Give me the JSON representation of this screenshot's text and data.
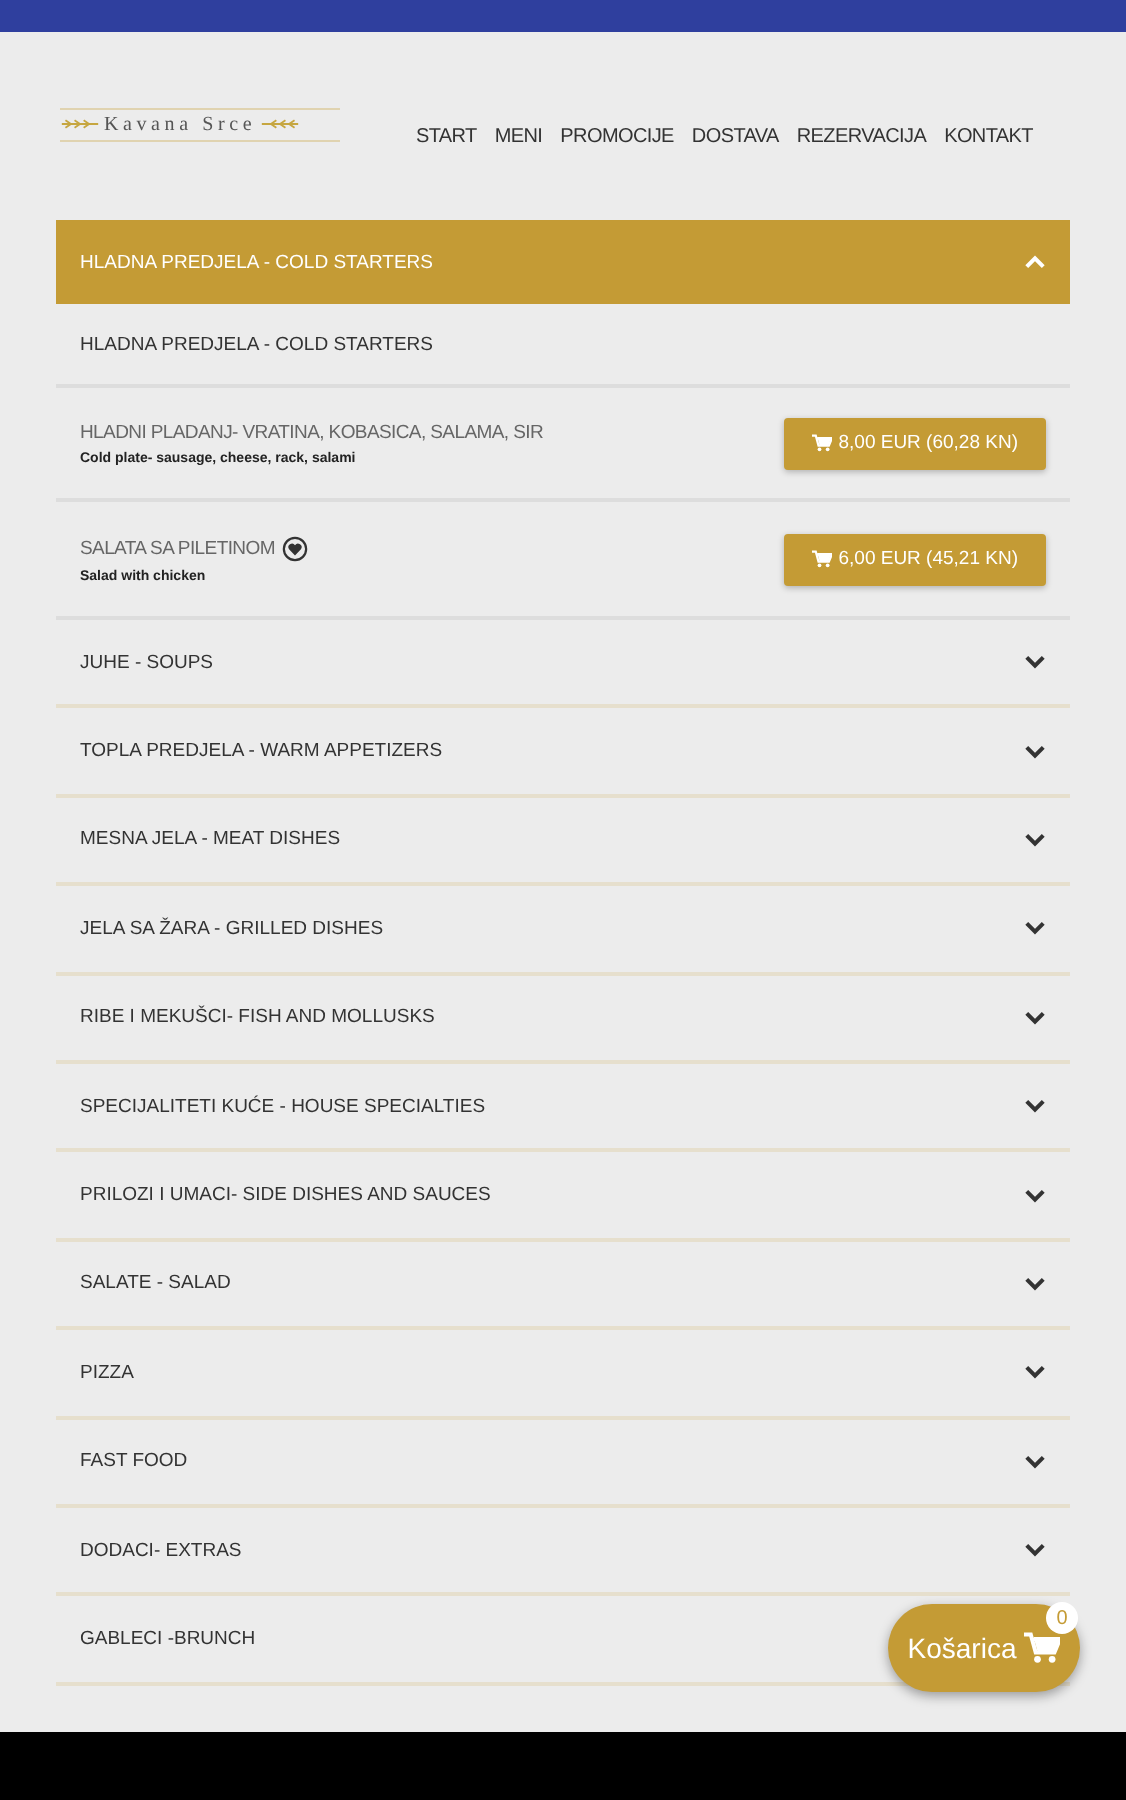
{
  "logo": {
    "text": "Kavana Srce"
  },
  "nav": [
    {
      "label": "START"
    },
    {
      "label": "MENI"
    },
    {
      "label": "PROMOCIJE"
    },
    {
      "label": "DOSTAVA"
    },
    {
      "label": "REZERVACIJA"
    },
    {
      "label": "KONTAKT"
    }
  ],
  "categories": [
    {
      "title": "HLADNA PREDJELA - COLD STARTERS",
      "expanded": true,
      "subtitle": "HLADNA PREDJELA - COLD STARTERS",
      "items": [
        {
          "name": "HLADNI PLADANJ- VRATINA, KOBASICA, SALAMA, SIR",
          "description": "Cold plate- sausage, cheese, rack, salami",
          "price": "8,00 EUR (60,28 KN)",
          "marked": false
        },
        {
          "name": "SALATA SA PILETINOM",
          "description": "Salad with chicken",
          "price": "6,00 EUR (45,21 KN)",
          "marked": true
        }
      ]
    },
    {
      "title": "JUHE - SOUPS",
      "expanded": false
    },
    {
      "title": "TOPLA PREDJELA - WARM APPETIZERS",
      "expanded": false
    },
    {
      "title": "MESNA JELA - MEAT DISHES",
      "expanded": false
    },
    {
      "title": "JELA SA ŽARA - GRILLED DISHES",
      "expanded": false
    },
    {
      "title": "RIBE I MEKUŠCI- FISH AND MOLLUSKS",
      "expanded": false
    },
    {
      "title": "SPECIJALITETI KUĆE - HOUSE SPECIALTIES",
      "expanded": false
    },
    {
      "title": "PRILOZI I UMACI- SIDE DISHES AND SAUCES",
      "expanded": false
    },
    {
      "title": "SALATE - SALAD",
      "expanded": false
    },
    {
      "title": "PIZZA",
      "expanded": false
    },
    {
      "title": "FAST FOOD",
      "expanded": false
    },
    {
      "title": "DODACI- EXTRAS",
      "expanded": false
    },
    {
      "title": "GABLECI -BRUNCH",
      "expanded": false
    }
  ],
  "cart": {
    "label": "Košarica",
    "count": "0"
  }
}
